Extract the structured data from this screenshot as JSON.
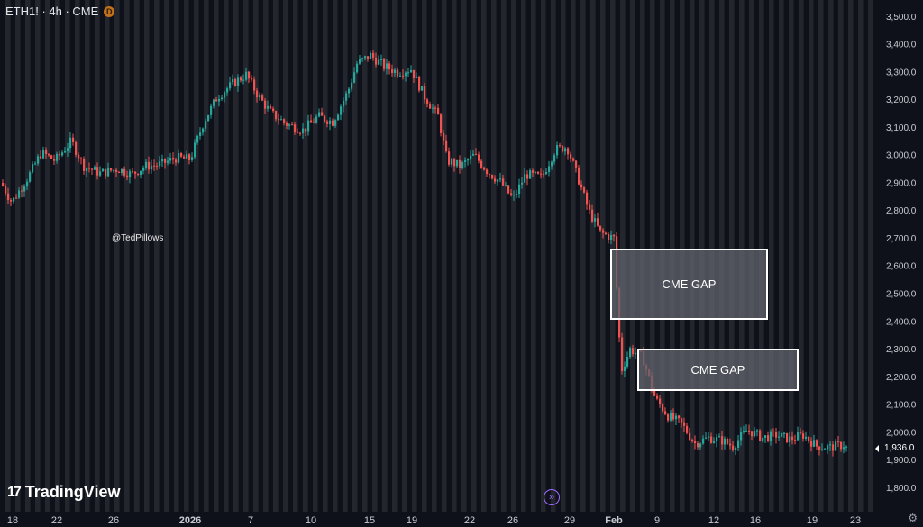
{
  "header": {
    "symbol_line": "ETH1! · 4h · CME",
    "badge": "D"
  },
  "watermark": "@TedPillows",
  "logo": {
    "mark": "17",
    "text": "TradingView"
  },
  "annotations": {
    "gap_upper_label": "CME GAP",
    "gap_lower_label": "CME GAP"
  },
  "current_price": {
    "label": "1,936.0",
    "value": 1936
  },
  "colors": {
    "background": "#0f111a",
    "up": "#26a69a",
    "down": "#ef5350",
    "stripe": "#24262d",
    "price_tag_border": "#ffffff"
  },
  "icons": {
    "go_to": "double-chevron-right-icon",
    "settings": "gear-icon"
  },
  "chart_data": {
    "type": "candlestick",
    "timeframe": "4h",
    "ylim": [
      1720,
      3540
    ],
    "y_ticks": [
      1800,
      1900,
      2000,
      2100,
      2200,
      2300,
      2400,
      2500,
      2600,
      2700,
      2800,
      2900,
      3000,
      3100,
      3200,
      3300,
      3400,
      3500
    ],
    "y_tick_labels": [
      "1,800.0",
      "1,900.0",
      "2,000.0",
      "2,100.0",
      "2,200.0",
      "2,300.0",
      "2,400.0",
      "2,500.0",
      "2,600.0",
      "2,700.0",
      "2,800.0",
      "2,900.0",
      "3,000.0",
      "3,100.0",
      "3,200.0",
      "3,300.0",
      "3,400.0",
      "3,500.0"
    ],
    "x_tick_labels": [
      "18",
      "22",
      "26",
      "2026",
      "7",
      "10",
      "15",
      "19",
      "22",
      "26",
      "29",
      "Feb",
      "9",
      "12",
      "16",
      "19",
      "23"
    ],
    "gap_zones": [
      {
        "label": "CME GAP",
        "low": 2410,
        "high": 2660
      },
      {
        "label": "CME GAP",
        "low": 2160,
        "high": 2300
      }
    ],
    "close_path": [
      [
        0,
        2900
      ],
      [
        12,
        2830
      ],
      [
        30,
        2920
      ],
      [
        45,
        3010
      ],
      [
        60,
        2980
      ],
      [
        78,
        3050
      ],
      [
        92,
        2960
      ],
      [
        110,
        2935
      ],
      [
        130,
        2950
      ],
      [
        145,
        2930
      ],
      [
        160,
        2960
      ],
      [
        175,
        2965
      ],
      [
        195,
        2990
      ],
      [
        210,
        2985
      ],
      [
        225,
        3120
      ],
      [
        240,
        3210
      ],
      [
        258,
        3260
      ],
      [
        272,
        3290
      ],
      [
        286,
        3210
      ],
      [
        300,
        3150
      ],
      [
        318,
        3110
      ],
      [
        335,
        3090
      ],
      [
        352,
        3140
      ],
      [
        368,
        3120
      ],
      [
        385,
        3230
      ],
      [
        395,
        3330
      ],
      [
        410,
        3360
      ],
      [
        425,
        3320
      ],
      [
        440,
        3300
      ],
      [
        455,
        3310
      ],
      [
        470,
        3210
      ],
      [
        485,
        3140
      ],
      [
        495,
        2980
      ],
      [
        510,
        2960
      ],
      [
        525,
        3000
      ],
      [
        540,
        2940
      ],
      [
        555,
        2900
      ],
      [
        568,
        2840
      ],
      [
        582,
        2930
      ],
      [
        600,
        2920
      ],
      [
        615,
        3020
      ],
      [
        628,
        3030
      ],
      [
        640,
        2920
      ],
      [
        652,
        2800
      ],
      [
        665,
        2720
      ],
      [
        680,
        2700
      ],
      [
        688,
        2220
      ],
      [
        698,
        2300
      ],
      [
        712,
        2270
      ],
      [
        726,
        2120
      ],
      [
        740,
        2060
      ],
      [
        755,
        2030
      ],
      [
        770,
        1960
      ],
      [
        785,
        1980
      ],
      [
        800,
        1970
      ],
      [
        812,
        1950
      ],
      [
        828,
        2010
      ],
      [
        845,
        1980
      ],
      [
        860,
        1990
      ],
      [
        875,
        1975
      ],
      [
        890,
        1990
      ],
      [
        905,
        1950
      ],
      [
        920,
        1945
      ],
      [
        935,
        1955
      ],
      [
        940,
        1936
      ]
    ]
  }
}
